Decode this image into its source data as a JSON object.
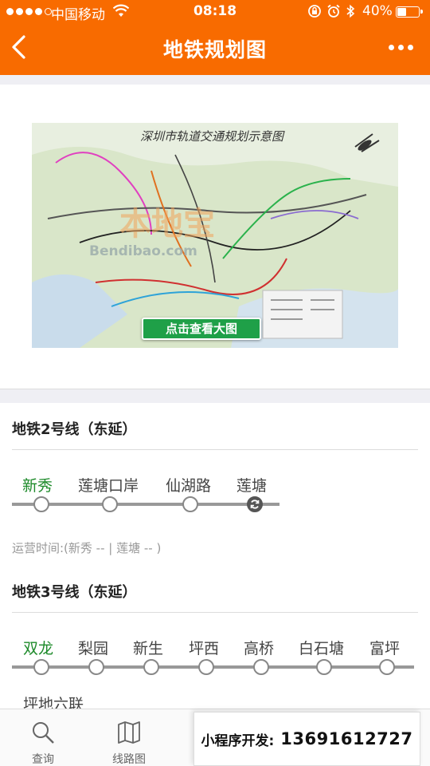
{
  "status_bar": {
    "carrier": "中国移动",
    "time": "08:18",
    "battery": "40%",
    "battery_level": 0.4,
    "signal_dots_filled": 4,
    "signal_dots_total": 5
  },
  "nav": {
    "title": "地铁规划图",
    "back_icon": "chevron-left-icon",
    "more_icon": "more-dots-icon"
  },
  "map": {
    "title": "深圳市轨道交通规划示意图",
    "watermark": "本地宝",
    "watermark_sub": "Bendibao.com",
    "button_label": "点击查看大图"
  },
  "lines": [
    {
      "title": "地铁2号线（东延）",
      "stations": [
        "新秀",
        "莲塘口岸",
        "仙湖路",
        "莲塘"
      ],
      "current_index": 3,
      "hours": "运营时间:(新秀 -- | 莲塘 -- )"
    },
    {
      "title": "地铁3号线（东延）",
      "stations": [
        "双龙",
        "梨园",
        "新生",
        "坪西",
        "高桥",
        "白石塘",
        "富坪"
      ],
      "overflow_station": "坪地六联"
    }
  ],
  "tabbar": {
    "tabs": [
      {
        "label": "查询",
        "icon": "search-icon"
      },
      {
        "label": "线路图",
        "icon": "map-icon"
      }
    ]
  },
  "promo": {
    "label": "小程序开发:",
    "phone": "13691612727"
  },
  "colors": {
    "brand": "#f86b00",
    "station_active": "#1d8a2a",
    "map_button": "#1fa048"
  }
}
